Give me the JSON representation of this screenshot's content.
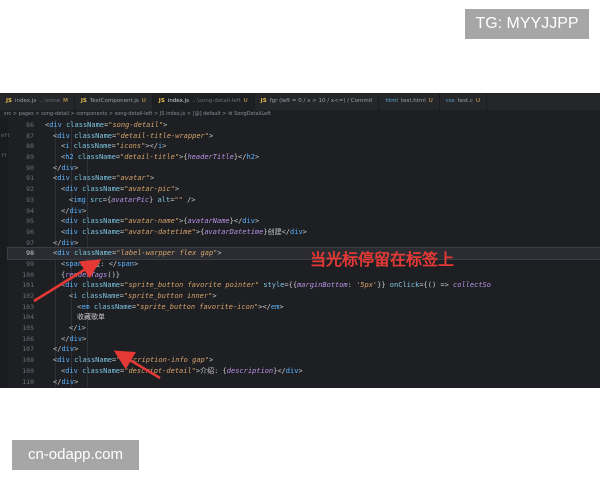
{
  "watermark_top": "TG: MYYJJPP",
  "watermark_bottom": "cn-odapp.com",
  "tabs": [
    {
      "icon": "JS",
      "label": "index.js",
      "suffix": "...\\mine",
      "mark": "M",
      "active": false
    },
    {
      "icon": "JS",
      "label": "TestComponent.js",
      "suffix": "",
      "mark": "U",
      "active": false
    },
    {
      "icon": "JS",
      "label": "index.js",
      "suffix": "...\\song-detail-left",
      "mark": "U",
      "active": true
    },
    {
      "icon": "JS",
      "label": "fgr (left = 0 / x > 10 / x<=) / Commit",
      "suffix": "",
      "mark": "",
      "active": false
    },
    {
      "icon": "html",
      "label": "test.html",
      "suffix": "",
      "mark": "U",
      "active": false
    },
    {
      "icon": "css",
      "label": "test.c",
      "suffix": "",
      "mark": "U",
      "active": false
    }
  ],
  "breadcrumb": "src > pages > song-detail > components > song-detail-left > JS index.js > [@] default > ⚙ SongDetailLeft",
  "left_gutter_labels": [
    "eft",
    "ft"
  ],
  "annotation_text": "当光标停留在标签上",
  "current_line": 98,
  "code_lines": [
    {
      "n": "86",
      "indent": 2,
      "segments": [
        [
          "o",
          "<"
        ],
        [
          "t",
          "div"
        ],
        [
          "a",
          " className"
        ],
        [
          "o",
          "="
        ],
        [
          "s",
          "\"song-detail\""
        ],
        [
          "o",
          ">"
        ]
      ]
    },
    {
      "n": "87",
      "indent": 3,
      "segments": [
        [
          "o",
          "<"
        ],
        [
          "t",
          "div"
        ],
        [
          "a",
          " className"
        ],
        [
          "o",
          "="
        ],
        [
          "s",
          "\"detail-title-wrapper\""
        ],
        [
          "o",
          ">"
        ]
      ]
    },
    {
      "n": "88",
      "indent": 4,
      "segments": [
        [
          "o",
          "<"
        ],
        [
          "t",
          "i"
        ],
        [
          "a",
          " className"
        ],
        [
          "o",
          "="
        ],
        [
          "s",
          "\"icons\""
        ],
        [
          "o",
          "></"
        ],
        [
          "t",
          "i"
        ],
        [
          "o",
          ">"
        ]
      ]
    },
    {
      "n": "89",
      "indent": 4,
      "segments": [
        [
          "o",
          "<"
        ],
        [
          "t",
          "h2"
        ],
        [
          "a",
          " className"
        ],
        [
          "o",
          "="
        ],
        [
          "s",
          "\"detail-title\""
        ],
        [
          "o",
          ">{"
        ],
        [
          "v",
          "headerTitle"
        ],
        [
          "o",
          "}</"
        ],
        [
          "t",
          "h2"
        ],
        [
          "o",
          ">"
        ]
      ]
    },
    {
      "n": "90",
      "indent": 3,
      "segments": [
        [
          "o",
          "</"
        ],
        [
          "t",
          "div"
        ],
        [
          "o",
          ">"
        ]
      ]
    },
    {
      "n": "91",
      "indent": 3,
      "segments": [
        [
          "o",
          "<"
        ],
        [
          "t",
          "div"
        ],
        [
          "a",
          " className"
        ],
        [
          "o",
          "="
        ],
        [
          "s",
          "\"avatar\""
        ],
        [
          "o",
          ">"
        ]
      ]
    },
    {
      "n": "92",
      "indent": 4,
      "segments": [
        [
          "o",
          "<"
        ],
        [
          "t",
          "div"
        ],
        [
          "a",
          " className"
        ],
        [
          "o",
          "="
        ],
        [
          "s",
          "\"avatar-pic\""
        ],
        [
          "o",
          ">"
        ]
      ]
    },
    {
      "n": "93",
      "indent": 5,
      "segments": [
        [
          "o",
          "<"
        ],
        [
          "t",
          "img"
        ],
        [
          "a",
          " src"
        ],
        [
          "o",
          "={"
        ],
        [
          "v",
          "avatarPic"
        ],
        [
          "o",
          "}"
        ],
        [
          "a",
          " alt"
        ],
        [
          "o",
          "="
        ],
        [
          "s",
          "\"\""
        ],
        [
          "o",
          " />"
        ]
      ]
    },
    {
      "n": "94",
      "indent": 4,
      "segments": [
        [
          "o",
          "</"
        ],
        [
          "t",
          "div"
        ],
        [
          "o",
          ">"
        ]
      ]
    },
    {
      "n": "95",
      "indent": 4,
      "segments": [
        [
          "o",
          "<"
        ],
        [
          "t",
          "div"
        ],
        [
          "a",
          " className"
        ],
        [
          "o",
          "="
        ],
        [
          "s",
          "\"avatar-name\""
        ],
        [
          "o",
          ">{"
        ],
        [
          "v",
          "avatarName"
        ],
        [
          "o",
          "}</"
        ],
        [
          "t",
          "div"
        ],
        [
          "o",
          ">"
        ]
      ]
    },
    {
      "n": "96",
      "indent": 4,
      "segments": [
        [
          "o",
          "<"
        ],
        [
          "t",
          "div"
        ],
        [
          "a",
          " className"
        ],
        [
          "o",
          "="
        ],
        [
          "s",
          "\"avatar-datetime\""
        ],
        [
          "o",
          ">{"
        ],
        [
          "v",
          "avatarDatetime"
        ],
        [
          "o",
          "}创建</"
        ],
        [
          "t",
          "div"
        ],
        [
          "o",
          ">"
        ]
      ]
    },
    {
      "n": "97",
      "indent": 3,
      "segments": [
        [
          "o",
          "</"
        ],
        [
          "t",
          "div"
        ],
        [
          "o",
          ">"
        ]
      ]
    },
    {
      "n": "98",
      "indent": 3,
      "segments": [
        [
          "o",
          "<"
        ],
        [
          "t",
          "div"
        ],
        [
          "a",
          " className"
        ],
        [
          "o",
          "="
        ],
        [
          "s",
          "\"label-warpper flex gap\""
        ],
        [
          "o",
          ">"
        ]
      ]
    },
    {
      "n": "99",
      "indent": 4,
      "segments": [
        [
          "o",
          "<"
        ],
        [
          "t",
          "span"
        ],
        [
          "o",
          ">标签: </"
        ],
        [
          "t",
          "span"
        ],
        [
          "o",
          ">"
        ]
      ]
    },
    {
      "n": "100",
      "indent": 4,
      "segments": [
        [
          "o",
          "{"
        ],
        [
          "v",
          "renderTags"
        ],
        [
          "o",
          "()}"
        ]
      ]
    },
    {
      "n": "101",
      "indent": 4,
      "segments": [
        [
          "o",
          "<"
        ],
        [
          "t",
          "div"
        ],
        [
          "a",
          " className"
        ],
        [
          "o",
          "="
        ],
        [
          "s",
          "\"sprite_button favorite pointer\""
        ],
        [
          "a",
          " style"
        ],
        [
          "o",
          "={{"
        ],
        [
          "v",
          "marginBottom"
        ],
        [
          "o",
          ": "
        ],
        [
          "s",
          "'5px'"
        ],
        [
          "o",
          "}}"
        ],
        [
          "a",
          " onClick"
        ],
        [
          "o",
          "={() => "
        ],
        [
          "v",
          "collectSo"
        ]
      ]
    },
    {
      "n": "102",
      "indent": 5,
      "segments": [
        [
          "o",
          "<"
        ],
        [
          "t",
          "i"
        ],
        [
          "a",
          " className"
        ],
        [
          "o",
          "="
        ],
        [
          "s",
          "\"sprite_button inner\""
        ],
        [
          "o",
          ">"
        ]
      ]
    },
    {
      "n": "103",
      "indent": 6,
      "segments": [
        [
          "o",
          "<"
        ],
        [
          "t",
          "em"
        ],
        [
          "a",
          " className"
        ],
        [
          "o",
          "="
        ],
        [
          "s",
          "\"sprite_button favorite-icon\""
        ],
        [
          "o",
          "></"
        ],
        [
          "t",
          "em"
        ],
        [
          "o",
          ">"
        ]
      ]
    },
    {
      "n": "104",
      "indent": 6,
      "segments": [
        [
          "o",
          "收藏歌单"
        ]
      ]
    },
    {
      "n": "105",
      "indent": 5,
      "segments": [
        [
          "o",
          "</"
        ],
        [
          "t",
          "i"
        ],
        [
          "o",
          ">"
        ]
      ]
    },
    {
      "n": "106",
      "indent": 4,
      "segments": [
        [
          "o",
          "</"
        ],
        [
          "t",
          "div"
        ],
        [
          "o",
          ">"
        ]
      ]
    },
    {
      "n": "107",
      "indent": 3,
      "segments": [
        [
          "o",
          "</"
        ],
        [
          "t",
          "div"
        ],
        [
          "o",
          ">"
        ]
      ]
    },
    {
      "n": "108",
      "indent": 3,
      "segments": [
        [
          "o",
          "<"
        ],
        [
          "t",
          "div"
        ],
        [
          "a",
          " className"
        ],
        [
          "o",
          "="
        ],
        [
          "s",
          "\"description-info gap\""
        ],
        [
          "o",
          ">"
        ]
      ]
    },
    {
      "n": "109",
      "indent": 4,
      "segments": [
        [
          "o",
          "<"
        ],
        [
          "t",
          "div"
        ],
        [
          "a",
          " className"
        ],
        [
          "o",
          "="
        ],
        [
          "s",
          "\"descript-detail\""
        ],
        [
          "o",
          ">介绍: {"
        ],
        [
          "v",
          "description"
        ],
        [
          "o",
          "}</"
        ],
        [
          "t",
          "div"
        ],
        [
          "o",
          ">"
        ]
      ]
    },
    {
      "n": "110",
      "indent": 3,
      "segments": [
        [
          "o",
          "</"
        ],
        [
          "t",
          "div"
        ],
        [
          "o",
          ">"
        ]
      ]
    }
  ],
  "colors": {
    "editor_bg": "#1e1f23",
    "tag": "#5ab3ff",
    "attr": "#7ec8e3",
    "string": "#d7a46b",
    "variable": "#b793e6",
    "annotation": "#e53935"
  }
}
